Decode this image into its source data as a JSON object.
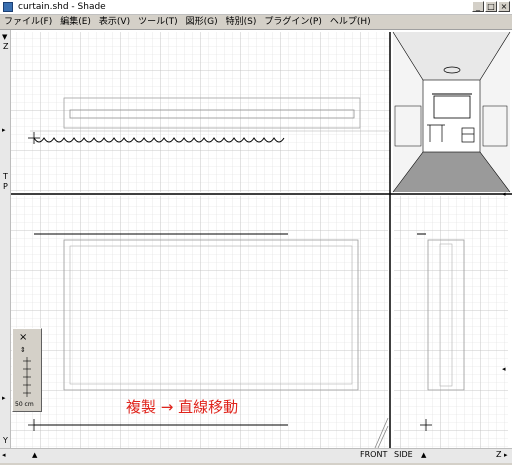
{
  "window": {
    "title": "curtain.shd - Shade",
    "minimize": "_",
    "maximize": "□",
    "close": "×"
  },
  "menu": [
    "ファイル(F)",
    "編集(E)",
    "表示(V)",
    "ツール(T)",
    "図形(G)",
    "特別(S)",
    "プラグイン(P)",
    "ヘルプ(H)"
  ],
  "axes": {
    "z_top": "Z",
    "y_bottom": "Y",
    "z_bottom_right": "Z",
    "t_mark": "T",
    "p_mark": "P"
  },
  "views": {
    "front": "FRONT",
    "side": "SIDE"
  },
  "palette": {
    "close": "×",
    "move": "⇕",
    "scale_label": "50 cm"
  },
  "caption": "複製 → 直線移動",
  "colors": {
    "caption": "#e0241c",
    "grid": "#d8d8d8",
    "grid_major": "#b8b8b8",
    "divider": "#000000"
  }
}
